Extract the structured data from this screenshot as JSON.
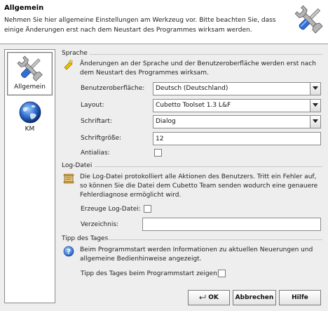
{
  "header": {
    "title": "Allgemein",
    "description": "Nehmen Sie hier allgemeine Einstellungen am Werkzeug vor. Bitte beachten Sie, dass einige Änderungen erst nach dem Neustart des Programmes wirksam werden.",
    "icon": "tools-icon"
  },
  "nav": {
    "items": [
      {
        "label": "Allgemein",
        "icon": "tools-icon",
        "selected": true
      },
      {
        "label": "KM",
        "icon": "globe-icon",
        "selected": false
      }
    ]
  },
  "sprache": {
    "title": "Sprache",
    "info": "Änderungen an der Sprache und der Benutzeroberfläche werden erst nach dem Neustart des Programmes wirksam.",
    "fields": {
      "benutzeroberflaeche": {
        "label": "Benutzeroberfläche:",
        "value": "Deutsch (Deutschland)"
      },
      "layout": {
        "label": "Layout:",
        "value": "Cubetto Toolset 1.3 L&F"
      },
      "schriftart": {
        "label": "Schriftart:",
        "value": "Dialog"
      },
      "schriftgroesse": {
        "label": "Schriftgröße:",
        "value": "12"
      },
      "antialias": {
        "label": "Antialias:",
        "checked": false
      }
    }
  },
  "logdatei": {
    "title": "Log-Datei",
    "info": "Die Log-Datei protokolliert alle Aktionen des Benutzers. Tritt ein Fehler auf, so können Sie die Datei dem Cubetto Team senden wodurch eine genauere Fehlerdiagnose ermöglicht wird.",
    "fields": {
      "erzeuge": {
        "label": "Erzeuge Log-Datei:",
        "checked": false
      },
      "verzeichnis": {
        "label": "Verzeichnis:",
        "value": ""
      }
    }
  },
  "tipp": {
    "title": "Tipp des Tages",
    "info": "Beim Programmstart werden Informationen zu aktuellen Neuerungen und allgemeine Bedienhinweise angezeigt.",
    "fields": {
      "zeigen": {
        "label": "Tipp des Tages beim Programmstart zeigen:",
        "checked": false
      }
    }
  },
  "buttons": {
    "ok": "OK",
    "abbrechen": "Abbrechen",
    "hilfe": "Hilfe"
  },
  "colors": {
    "background": "#eeeeee",
    "header_background": "#ffffff",
    "border": "#8a8a8a"
  }
}
